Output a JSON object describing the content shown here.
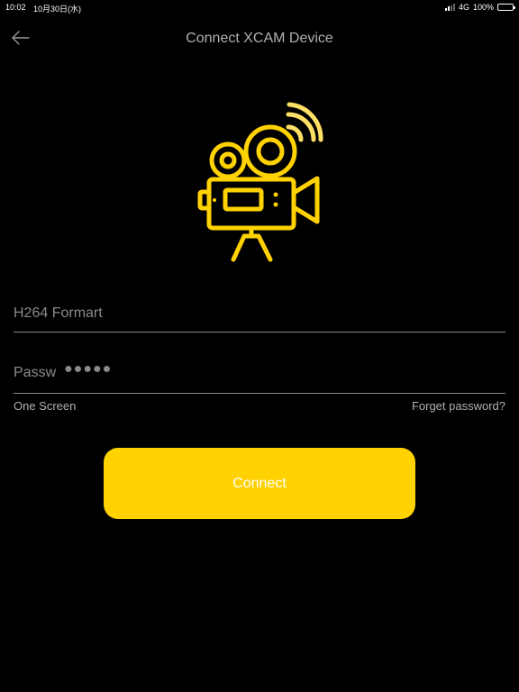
{
  "status_bar": {
    "time": "10:02",
    "date": "10月30日(水)",
    "network": "4G",
    "battery": "100%",
    "signal_icon": "signal-bars-icon",
    "battery_icon": "battery-full-icon"
  },
  "nav": {
    "back_icon": "arrow-left-icon",
    "title": "Connect XCAM Device"
  },
  "hero": {
    "icon": "video-camera-wifi-icon",
    "accent_color": "#ffd200",
    "wifi_color": "#ffe066"
  },
  "form": {
    "format_field": {
      "label": "H264 Formart"
    },
    "password_field": {
      "label": "Passw",
      "masked_value": "●●●●●"
    },
    "one_screen_label": "One Screen",
    "forgot_password_label": "Forget password?"
  },
  "connect_button": {
    "label": "Connect",
    "color": "#ffd200"
  }
}
